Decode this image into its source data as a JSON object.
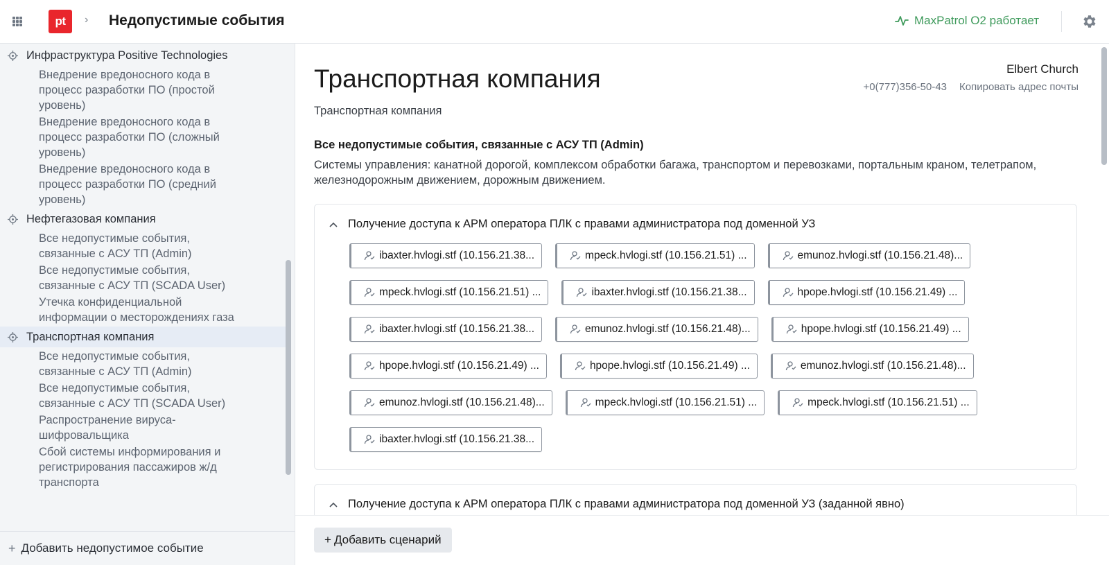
{
  "header": {
    "title": "Недопустимые события",
    "logo_text": "pt",
    "status_text": "MaxPatrol O2 работает",
    "status_color": "#3e9a5b",
    "accent_color": "#e9262c"
  },
  "sidebar": {
    "groups": [
      {
        "label": "Инфраструктура Positive Technologies",
        "active": false,
        "items": [
          "Внедрение вредоносного кода в процесс разработки ПО (простой уровень)",
          "Внедрение вредоносного кода в процесс разработки ПО (сложный уровень)",
          "Внедрение вредоносного кода в процесс разработки ПО (средний уровень)"
        ]
      },
      {
        "label": "Нефтегазовая компания",
        "active": false,
        "items": [
          "Все недопустимые события, связанные с АСУ ТП (Admin)",
          "Все недопустимые события, связанные с АСУ ТП (SCADA User)",
          "Утечка конфиденциальной информации о месторождениях газа"
        ]
      },
      {
        "label": "Транспортная компания",
        "active": true,
        "items": [
          "Все недопустимые события, связанные с АСУ ТП (Admin)",
          "Все недопустимые события, связанные с АСУ ТП (SCADA User)",
          "Распространение вируса-шифровальщика",
          "Сбой системы информирования и регистрирования пассажиров ж/д транспорта"
        ]
      }
    ],
    "add_event_label": "Добавить недопустимое событие"
  },
  "main": {
    "company_title": "Транспортная компания",
    "company_subtitle": "Транспортная компания",
    "contact": {
      "name": "Elbert Church",
      "phone": "+0(777)356-50-43",
      "copy_email_label": "Копировать адрес почты"
    },
    "section_title": "Все недопустимые события, связанные с АСУ ТП (Admin)",
    "section_description": "Системы управления: канатной дорогой, комплексом обработки багажа, транспортом и перевозками, портальным краном, телетрапом, железнодорожным движением, дорожным движением.",
    "scenarios": [
      {
        "title": "Получение доступа к АРМ оператора ПЛК с правами администратора под доменной УЗ",
        "chip_rows": [
          [
            "ibaxter.hvlogi.stf (10.156.21.38...",
            "mpeck.hvlogi.stf (10.156.21.51) ...",
            "emunoz.hvlogi.stf (10.156.21.48)..."
          ],
          [
            "mpeck.hvlogi.stf (10.156.21.51) ...",
            "ibaxter.hvlogi.stf (10.156.21.38...",
            "hpope.hvlogi.stf (10.156.21.49) ..."
          ],
          [
            "ibaxter.hvlogi.stf (10.156.21.38...",
            "emunoz.hvlogi.stf (10.156.21.48)...",
            "hpope.hvlogi.stf (10.156.21.49) ..."
          ],
          [
            "hpope.hvlogi.stf (10.156.21.49) ...",
            "hpope.hvlogi.stf (10.156.21.49) ...",
            "emunoz.hvlogi.stf (10.156.21.48)..."
          ],
          [
            "emunoz.hvlogi.stf (10.156.21.48)...",
            "mpeck.hvlogi.stf (10.156.21.51) ...",
            "mpeck.hvlogi.stf (10.156.21.51) ..."
          ],
          [
            "ibaxter.hvlogi.stf (10.156.21.38..."
          ]
        ]
      },
      {
        "title": "Получение доступа к АРМ оператора ПЛК с правами администратора под доменной УЗ (заданной явно)",
        "chip_rows": []
      }
    ],
    "add_scenario_label": "Добавить сценарий"
  }
}
